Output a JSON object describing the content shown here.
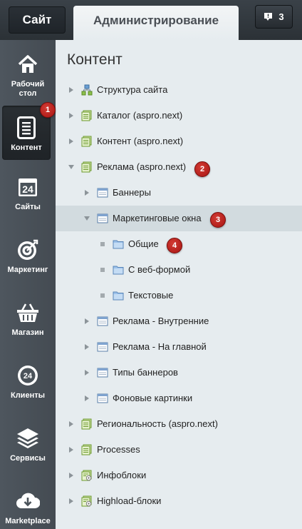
{
  "topbar": {
    "site_tab": "Сайт",
    "admin_tab": "Администрирование",
    "notifications_count": "3"
  },
  "leftnav": [
    {
      "label_lines": [
        "Рабочий",
        "стол"
      ],
      "icon": "home-icon"
    },
    {
      "label_lines": [
        "Контент"
      ],
      "icon": "document-icon",
      "active": true
    },
    {
      "label_lines": [
        "Сайты"
      ],
      "icon": "calendar-24-icon"
    },
    {
      "label_lines": [
        "Маркетинг"
      ],
      "icon": "target-icon"
    },
    {
      "label_lines": [
        "Магазин"
      ],
      "icon": "basket-icon"
    },
    {
      "label_lines": [
        "Клиенты"
      ],
      "icon": "clients-24-icon"
    },
    {
      "label_lines": [
        "Сервисы"
      ],
      "icon": "layers-icon"
    },
    {
      "label_lines": [
        "Marketplace"
      ],
      "icon": "cloud-download-icon"
    }
  ],
  "panel": {
    "title": "Контент"
  },
  "tree": [
    {
      "label": "Структура сайта",
      "level": 0,
      "toggle": "right",
      "icon": "structure-icon"
    },
    {
      "label": "Каталог (aspro.next)",
      "level": 0,
      "toggle": "right",
      "icon": "green-list-icon"
    },
    {
      "label": "Контент (aspro.next)",
      "level": 0,
      "toggle": "right",
      "icon": "green-list-icon"
    },
    {
      "label": "Реклама (aspro.next)",
      "level": 0,
      "toggle": "down",
      "icon": "green-list-icon"
    },
    {
      "label": "Баннеры",
      "level": 1,
      "toggle": "right",
      "icon": "window-icon"
    },
    {
      "label": "Маркетинговые окна",
      "level": 1,
      "toggle": "down",
      "icon": "window-icon",
      "selected": true
    },
    {
      "label": "Общие",
      "level": 2,
      "toggle": "dot",
      "icon": "folder-icon"
    },
    {
      "label": "С веб-формой",
      "level": 2,
      "toggle": "dot",
      "icon": "folder-icon"
    },
    {
      "label": "Текстовые",
      "level": 2,
      "toggle": "dot",
      "icon": "folder-icon"
    },
    {
      "label": "Реклама - Внутренние",
      "level": 1,
      "toggle": "right",
      "icon": "window-icon"
    },
    {
      "label": "Реклама - На главной",
      "level": 1,
      "toggle": "right",
      "icon": "window-icon"
    },
    {
      "label": "Типы баннеров",
      "level": 1,
      "toggle": "right",
      "icon": "window-icon"
    },
    {
      "label": "Фоновые картинки",
      "level": 1,
      "toggle": "right",
      "icon": "window-icon"
    },
    {
      "label": "Региональность (aspro.next)",
      "level": 0,
      "toggle": "right",
      "icon": "green-list-icon"
    },
    {
      "label": "Processes",
      "level": 0,
      "toggle": "right",
      "icon": "green-list-icon"
    },
    {
      "label": "Инфоблоки",
      "level": 0,
      "toggle": "right",
      "icon": "gear-list-icon"
    },
    {
      "label": "Highload-блоки",
      "level": 0,
      "toggle": "right",
      "icon": "gear-list-icon"
    }
  ],
  "badges": [
    "1",
    "2",
    "3",
    "4"
  ],
  "colors": {
    "badge_red": "#b71c18",
    "nav_bg": "#4a5158",
    "selected_row": "#d2dbdf"
  }
}
